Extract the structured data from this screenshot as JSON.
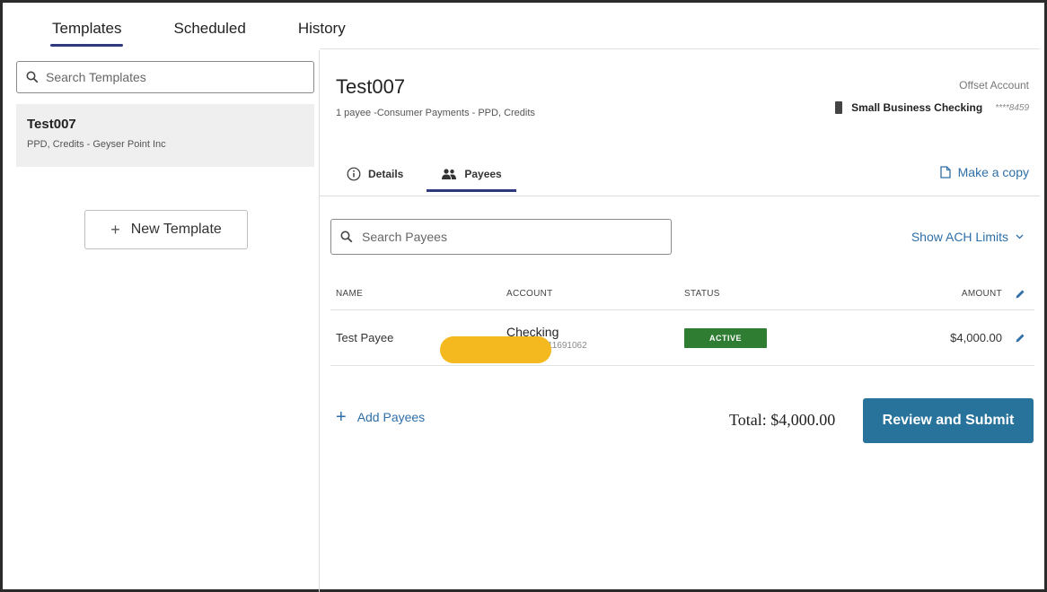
{
  "top_tabs": [
    {
      "label": "Templates",
      "active": true
    },
    {
      "label": "Scheduled",
      "active": false
    },
    {
      "label": "History",
      "active": false
    }
  ],
  "sidebar": {
    "search_placeholder": "Search Templates",
    "template": {
      "name": "Test007",
      "subtitle": "PPD, Credits - Geyser Point Inc"
    },
    "new_template_label": "New Template"
  },
  "header": {
    "title": "Test007",
    "subtitle": "1 payee -Consumer Payments - PPD, Credits",
    "offset_label": "Offset Account",
    "offset_account_name": "Small Business Checking",
    "offset_account_mask": "****8459"
  },
  "detail_tabs": [
    {
      "label": "Details",
      "icon": "info-icon",
      "active": false
    },
    {
      "label": "Payees",
      "icon": "people-icon",
      "active": true
    }
  ],
  "make_copy_label": "Make a copy",
  "payees": {
    "search_placeholder": "Search Payees",
    "ach_limits_label": "Show ACH Limits",
    "columns": {
      "name": "NAME",
      "account": "ACCOUNT",
      "status": "STATUS",
      "amount": "AMOUNT"
    },
    "rows": [
      {
        "name": "Test Payee",
        "account_type": "Checking",
        "account_number": "9 211691062",
        "status": "ACTIVE",
        "amount": "$4,000.00"
      }
    ],
    "add_label": "Add Payees",
    "total_label": "Total: $4,000.00"
  },
  "review_submit_label": "Review and Submit",
  "colors": {
    "accent": "#2e3a7d",
    "link": "#2f6fa8",
    "primary_button": "#27739b",
    "status_active": "#2e7d32",
    "redaction": "#f3b91e"
  }
}
